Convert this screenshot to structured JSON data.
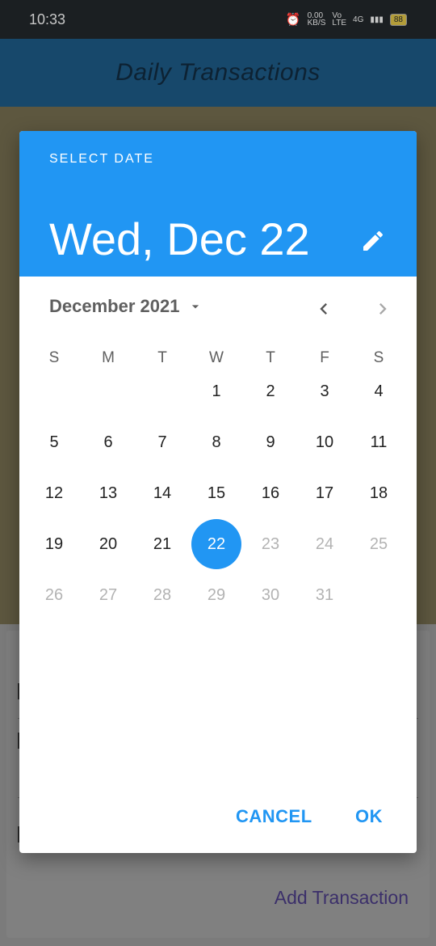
{
  "status_bar": {
    "time": "10:33",
    "net_speed": "0.00\nKB/S",
    "volte": "Vo\nLTE",
    "signal": "4G",
    "battery": "88"
  },
  "app_bar": {
    "title": "Daily Transactions"
  },
  "background": {
    "add_transaction_label": "Add Transaction"
  },
  "dialog": {
    "label": "SELECT DATE",
    "header_date": "Wed, Dec 22",
    "month_year": "December 2021",
    "weekdays": [
      "S",
      "M",
      "T",
      "W",
      "T",
      "F",
      "S"
    ],
    "first_weekday_index": 3,
    "days_in_month": 31,
    "selected_day": 22,
    "last_enabled_day": 22,
    "cancel_label": "CANCEL",
    "ok_label": "OK",
    "accent_color": "#2196f3",
    "icons": {
      "edit": "pencil-icon",
      "dropdown": "arrow-drop-down-icon",
      "prev": "chevron-left-icon",
      "next": "chevron-right-icon"
    }
  }
}
